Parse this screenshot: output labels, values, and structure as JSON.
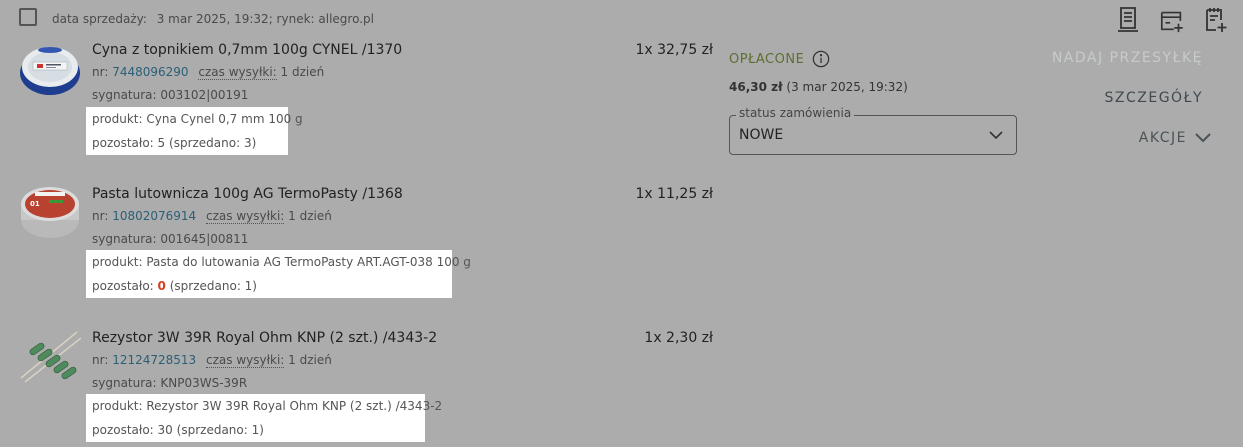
{
  "sale": {
    "date_label": "data sprzedaży:",
    "date_value": "3 mar 2025, 19:32; rynek: allegro.pl"
  },
  "items": [
    {
      "title": "Cyna z topnikiem 0,7mm 100g CYNEL /1370",
      "nr_label": "nr:",
      "nr": "7448096290",
      "ship_label": "czas wysyłki:",
      "ship_value": "1 dzień",
      "signature": "sygnatura: 003102|00191",
      "product": "produkt: Cyna Cynel 0,7 mm 100 g",
      "remaining_prefix": "pozostało:",
      "remaining": "5",
      "sold": "(sprzedano: 3)",
      "quantity": "1x 32,75 zł"
    },
    {
      "title": "Pasta lutownicza 100g AG TermoPasty /1368",
      "nr_label": "nr:",
      "nr": "10802076914",
      "ship_label": "czas wysyłki:",
      "ship_value": "1 dzień",
      "signature": "sygnatura: 001645|00811",
      "product": "produkt: Pasta do lutowania AG TermoPasty ART.AGT-038 100 g",
      "remaining_prefix": "pozostało:",
      "remaining": "0",
      "sold": "(sprzedano: 1)",
      "quantity": "1x 11,25 zł"
    },
    {
      "title": "Rezystor 3W 39R Royal Ohm KNP (2 szt.) /4343-2",
      "nr_label": "nr:",
      "nr": "12124728513",
      "ship_label": "czas wysyłki:",
      "ship_value": "1 dzień",
      "signature": "sygnatura: KNP03WS-39R",
      "product": "produkt: Rezystor 3W 39R Royal Ohm KNP (2 szt.) /4343-2",
      "remaining_prefix": "pozostało:",
      "remaining": "30",
      "sold": "(sprzedano: 1)",
      "quantity": "1x 2,30 zł"
    }
  ],
  "payment": {
    "status": "OPŁACONE",
    "amount": "46,30 zł",
    "date": "(3 mar 2025, 19:32)"
  },
  "order_status": {
    "label": "status zamówienia",
    "value": "NOWE"
  },
  "actions": {
    "ship": "NADAJ PRZESYŁKĘ",
    "details": "SZCZEGÓŁY",
    "more": "AKCJE"
  },
  "icons": {
    "top": [
      "receipt-icon",
      "add-invoice-icon",
      "add-note-icon"
    ],
    "info": "info-icon",
    "chevron": "chevron-down-icon"
  },
  "colors": {
    "paid": "#5d6f33",
    "zero_stock": "#d4401e",
    "link_number": "#2b5f77"
  }
}
